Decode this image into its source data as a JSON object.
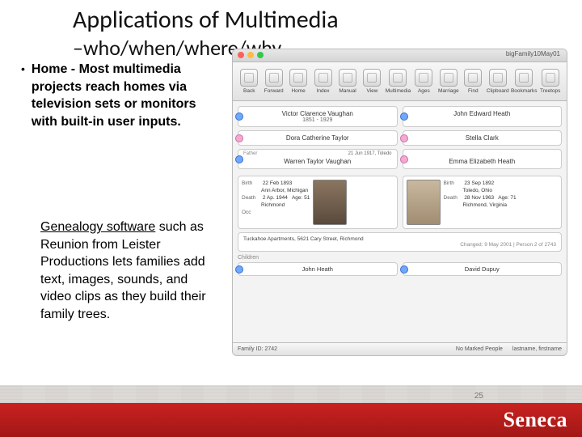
{
  "title": "Applications of Multimedia",
  "subtitle": "–who/when/where/why",
  "bullet": "Home - Most multimedia projects reach homes via television sets or monitors with built-in user inputs.",
  "para2_underlined": "Genealogy software",
  "para2_rest": " such as Reunion from Leister Productions lets families add text, images, sounds, and video clips as they build their family trees.",
  "brand": "Seneca",
  "page_num": "25",
  "screenshot": {
    "doc_title": "bigFamily10May01",
    "toolbar": [
      "Back",
      "Forward",
      "Home",
      "Index",
      "Manual",
      "View",
      "Multimedia",
      "Ages",
      "Marriage",
      "Find",
      "Clipboard",
      "Bookmarks",
      "Treetops"
    ],
    "father": {
      "name": "Victor Clarence Vaughan",
      "dates": "1851 - 1929"
    },
    "mother": {
      "name": "John Edward Heath"
    },
    "wife_line": {
      "name": "Dora Catherine Taylor",
      "right": "Stella Clark"
    },
    "husband": {
      "tag": "Father",
      "name": "Warren Taylor Vaughan",
      "life": "21 Jun 1917, Toledo",
      "birth": "22 Feb 1893",
      "birth_place": "Ann Arbor, Michigan",
      "death": "2 Ap. 1944",
      "death_place": "Richmond",
      "age": "Age: 51",
      "occ": "Occ"
    },
    "wife": {
      "name": "Emma Elizabeth Heath",
      "birth": "23 Sep 1892",
      "birth_place": "Toledo, Ohio",
      "death": "28 Nov 1963",
      "death_place": "Richmond, Virginia",
      "age": "Age: 71"
    },
    "event": {
      "addr": "Tuckahoe Apartments, 5621 Cary Street, Richmond",
      "changed": "Changed: 9 May 2001 | Person 2 of 2743"
    },
    "children_label": "Children",
    "children": [
      "John Heath",
      "David Dupuy"
    ],
    "status": {
      "family_id": "Family ID: 2742",
      "marked": "No Marked People",
      "sort": "lastname, firstname"
    }
  }
}
